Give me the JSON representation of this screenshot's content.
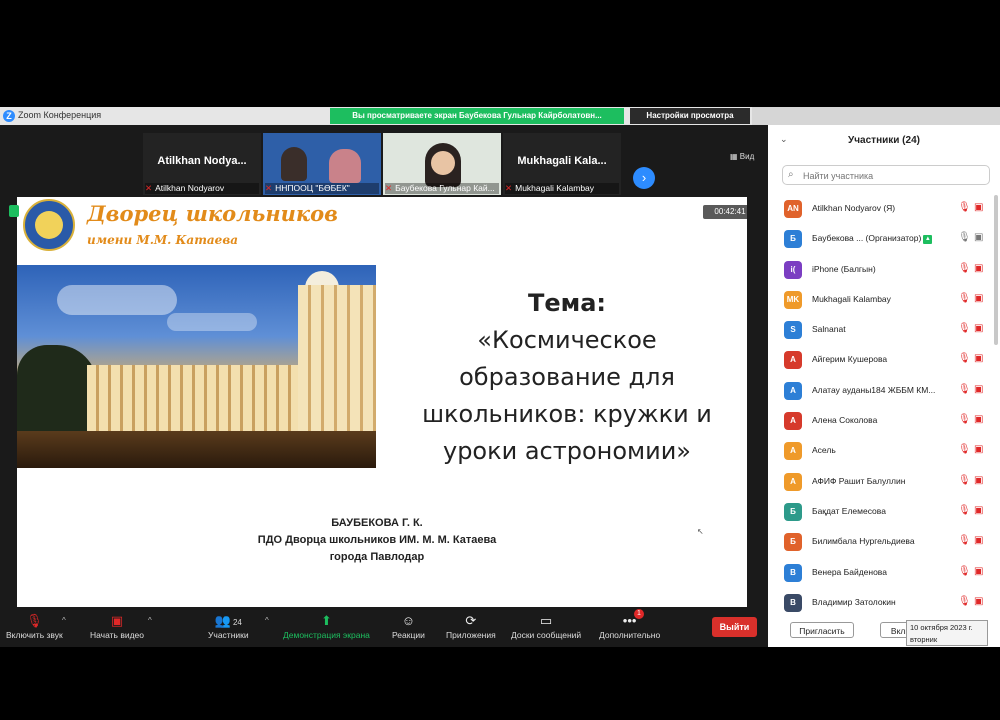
{
  "app": {
    "title": "Zoom Конференция",
    "logo_letter": "Z"
  },
  "share_banner": "Вы просматриваете экран Баубекова Гульнар Кайрболатовн...",
  "view_settings": "Настройки просмотра",
  "view_label": "Вид",
  "videos": [
    {
      "big": "Atilkhan  Nodya...",
      "caption": "Atilkhan Nodyarov"
    },
    {
      "big": "",
      "caption": "ННПООЦ \"БӨБЕК\""
    },
    {
      "big": "",
      "caption": "Баубекова Гульнар Кай..."
    },
    {
      "big": "Mukhagali  Kala...",
      "caption": "Mukhagali Kalambay"
    }
  ],
  "slide": {
    "title": "Дворец школьников",
    "subtitle": "имени М.М. Катаева",
    "timer": "00:42:41",
    "tema_head": "Тема:",
    "tema_lines": [
      "«Космическое",
      "образование для",
      "школьников: кружки и",
      "уроки астрономии»"
    ],
    "author_lines": [
      "БАУБЕКОВА Г. К.",
      "ПДО Дворца школьников ИМ. М. М. Катаева",
      "города Павлодар"
    ]
  },
  "toolbar": {
    "unmute": "Включить звук",
    "start_video": "Начать видео",
    "participants": "Участники",
    "participants_count": "24",
    "share": "Демонстрация экрана",
    "reactions": "Реакции",
    "apps": "Приложения",
    "whiteboards": "Доски сообщений",
    "more": "Дополнительно",
    "more_badge": "1",
    "end": "Выйти"
  },
  "panel": {
    "title": "Участники (24)",
    "search_placeholder": "Найти участника",
    "participants": [
      {
        "initials": "AN",
        "color": "#e0622b",
        "name": "Atilkhan Nodyarov (Я)"
      },
      {
        "initials": "Б",
        "color": "#2d7fd6",
        "name": "Баубекова ... (Организатор)"
      },
      {
        "initials": "i(",
        "color": "#7b3ec2",
        "name": "iPhone (Балгын)"
      },
      {
        "initials": "MK",
        "color": "#ef9a2a",
        "name": "Mukhagali Kalambay"
      },
      {
        "initials": "S",
        "color": "#2d7fd6",
        "name": "Salnanat"
      },
      {
        "initials": "А",
        "color": "#d63a2b",
        "name": "Айгерим Кушерова"
      },
      {
        "initials": "А",
        "color": "#2d7fd6",
        "name": "Алатау ауданы184 ЖББМ КМ..."
      },
      {
        "initials": "А",
        "color": "#d63a2b",
        "name": "Алена Соколова"
      },
      {
        "initials": "А",
        "color": "#ef9a2a",
        "name": "Асель"
      },
      {
        "initials": "А",
        "color": "#ef9a2a",
        "name": "АФИФ  Рашит Балуллин"
      },
      {
        "initials": "Б",
        "color": "#2d9a8a",
        "name": "Бақдат Елемесова"
      },
      {
        "initials": "Б",
        "color": "#e0622b",
        "name": "Билимбала Нургельдиева"
      },
      {
        "initials": "В",
        "color": "#2d7fd6",
        "name": "Венера Байденова"
      },
      {
        "initials": "В",
        "color": "#3a4a66",
        "name": "Владимир Затолокин"
      }
    ],
    "invite": "Пригласить",
    "enable": "Включить",
    "date_line1": "10 октября 2023 г.",
    "date_line2": "вторник"
  }
}
